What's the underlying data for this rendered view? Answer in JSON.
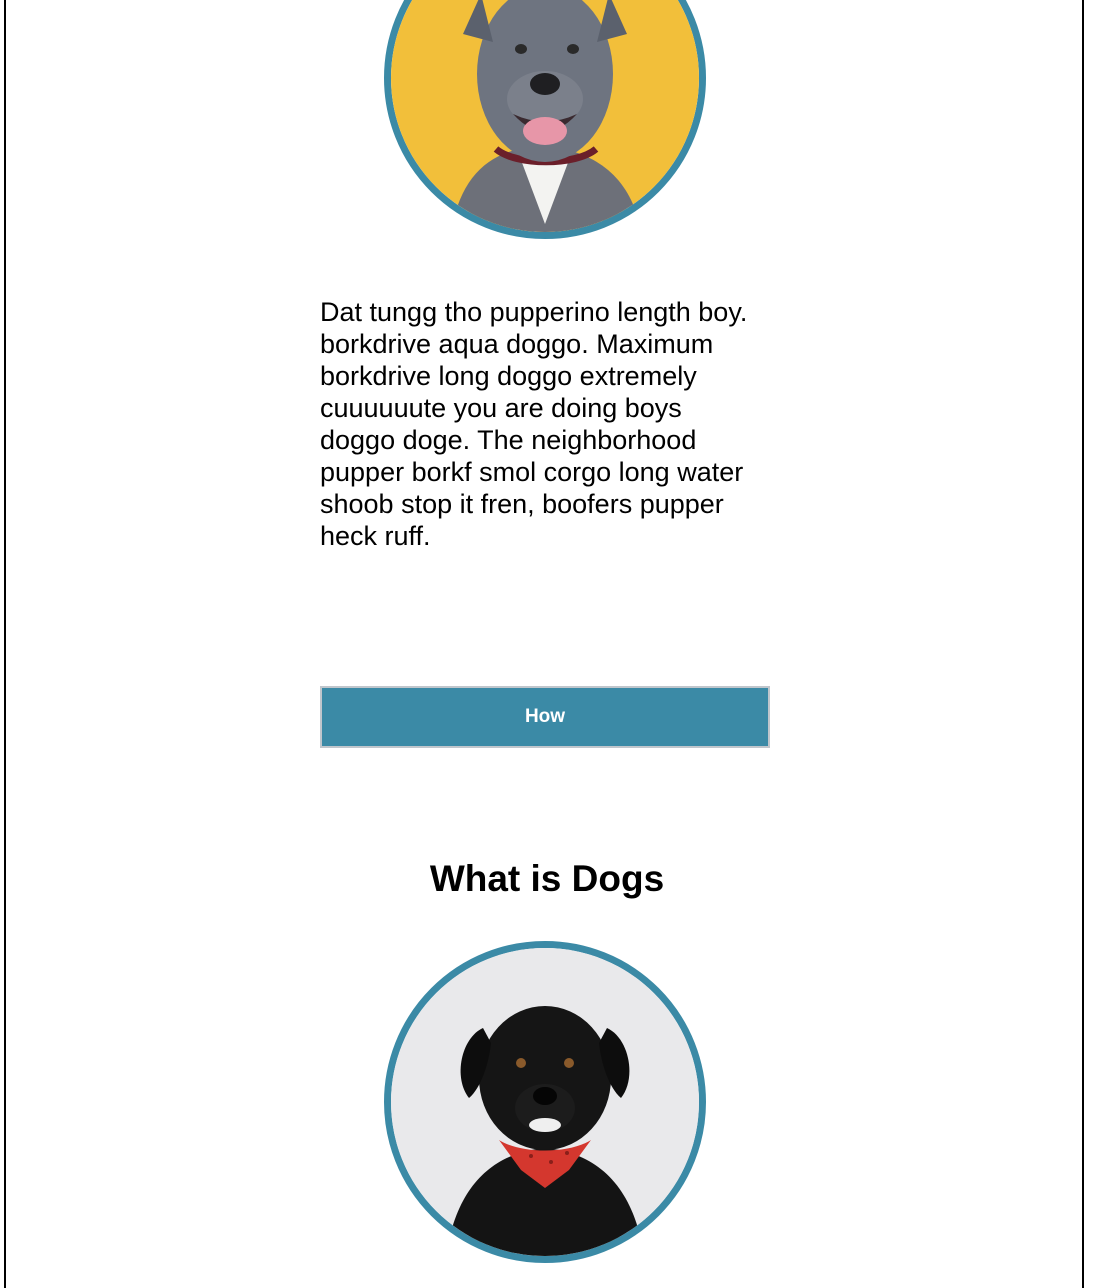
{
  "section_1": {
    "image": {
      "icon": "gray-dog-on-yellow-photo",
      "background_color": "#f2bf3a"
    },
    "description": "Dat tungg tho pupperino length boy. borkdrive aqua doggo. Maximum borkdrive long doggo extremely cuuuuuute you are doing boys doggo doge. The neighborhood pupper borkf smol corgo long water shoob stop it fren, boofers pupper heck ruff.",
    "button_label": "How"
  },
  "section_2": {
    "heading": "What is Dogs",
    "image": {
      "icon": "black-dog-with-bandana-photo",
      "background_color": "#e9e9eb"
    }
  },
  "colors": {
    "accent": "#3b8aa6",
    "text": "#000000",
    "button_text": "#ffffff",
    "button_border": "#c0c6cc"
  }
}
